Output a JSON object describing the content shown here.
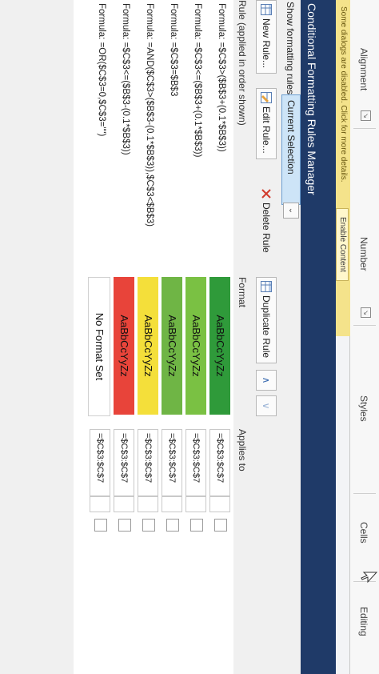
{
  "ribbon": {
    "groups": [
      "Alignment",
      "Number",
      "Styles",
      "Cells",
      "Editing"
    ]
  },
  "notification": {
    "message": "Some dialogs are disabled. Click for more details.",
    "button": "Enable Content"
  },
  "dialog": {
    "title": "Conditional Formatting Rules Manager",
    "show_label": "Show formatting rules for:",
    "show_value": "Current Selection",
    "buttons": {
      "new_rule": "New Rule...",
      "edit_rule": "Edit Rule...",
      "delete_rule": "Delete Rule",
      "duplicate_rule": "Duplicate Rule"
    },
    "columns": {
      "rule": "Rule (applied in order shown)",
      "format": "Format",
      "applies_to": "Applies to"
    },
    "rules": [
      {
        "formula": "Formula: =$C$3>($B$3+(0.1*$B$3))",
        "format": "AaBbCcYyZz",
        "color": "#2f9a3a",
        "applies_to": "=$C$3:$C$7"
      },
      {
        "formula": "Formula: =$C$3<=($B$3+(0.1*$B$3))",
        "format": "AaBbCcYyZz",
        "color": "#7ac143",
        "applies_to": "=$C$3:$C$7"
      },
      {
        "formula": "Formula: =$C$3=$B$3",
        "format": "AaBbCcYyZz",
        "color": "#6fb545",
        "applies_to": "=$C$3:$C$7"
      },
      {
        "formula": "Formula: =AND($C$3>($B$3-(0.1*$B$3)),$C$3<$B$3)",
        "format": "AaBbCcYyZz",
        "color": "#f4df3a",
        "applies_to": "=$C$3:$C$7"
      },
      {
        "formula": "Formula: =$C$3<=($B$3-(0.1*$B$3))",
        "format": "AaBbCcYyZz",
        "color": "#e8443a",
        "applies_to": "=$C$3:$C$7"
      },
      {
        "formula": "Formula: =OR($C$3=0,$C$3=\"\")",
        "format": "No Format Set",
        "color": "#ffffff",
        "applies_to": "=$C$3:$C$7"
      }
    ]
  }
}
